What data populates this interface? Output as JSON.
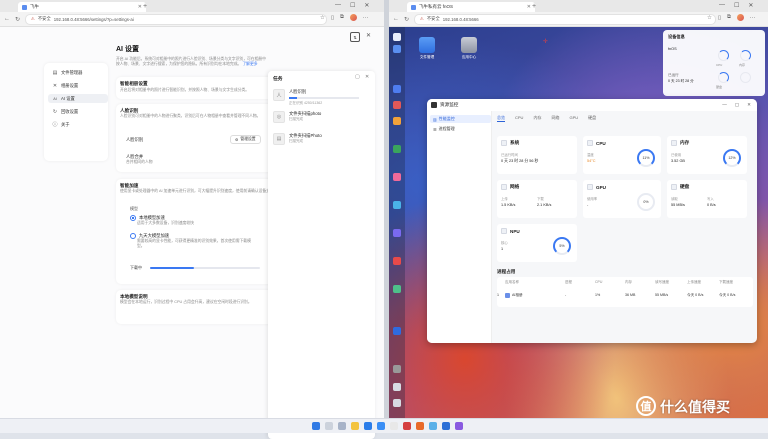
{
  "left_browser": {
    "tab_title": "飞牛",
    "url_warning": "不安全",
    "url": "192.168.0.48:5666/settings/?p=settings-ai",
    "new_tab_symbol": "+",
    "window_buttons": [
      "—",
      "☐",
      "✕"
    ]
  },
  "right_browser": {
    "tab_title": "飞牛私有云 fnOS",
    "url_warning": "不安全",
    "url": "192.168.0.48:5666",
    "new_tab_symbol": "+",
    "window_buttons": [
      "—",
      "☐",
      "✕"
    ]
  },
  "settings": {
    "sidebar": [
      {
        "icon": "▤",
        "label": "文件管理器"
      },
      {
        "icon": "✕",
        "label": "相册设置"
      },
      {
        "icon": "AI",
        "label": "AI 设置"
      },
      {
        "icon": "↻",
        "label": "回收设置"
      },
      {
        "icon": "ⓘ",
        "label": "关于"
      }
    ],
    "title": "AI 设置",
    "description": "开启 AI 功能后，系统可对相册中的照片进行人脸识别、场景分类与文字识别，可在相册中按人物、场景、文字进行搜索，为保护您的隐私，所有识别均在本地完成。",
    "description_link": "了解更多",
    "section1": {
      "title": "智能相册设置",
      "text": "开启后将对相册中的照片进行智能识别，并按照人物、场景与文字生成分类。"
    },
    "section2": {
      "title": "人脸识别",
      "text": "人脸识别可对相册中的人物进行聚类，识别后可在人物相册中查看并管理不同人物。",
      "row_label": "人脸识别",
      "button": "管理设置",
      "row2_label": "人脸合并",
      "row2_sub": "合并相同的人物"
    },
    "section3": {
      "title": "智能加速",
      "text": "使用显卡或处理器中的 AI 加速单元进行识别，可大幅提升识别速度，使用前请确认设备支持。",
      "group_label": "模型",
      "option1": "本地模型加速",
      "option1_sub": "适用于大多数设备，识别速度较快",
      "option2": "九天大模型加速",
      "option2_sub": "需要较高的显卡性能，可获得更精准的识别效果，首次使用需下载模型。",
      "progress_label": "下载中",
      "progress": 0.4
    },
    "section4": {
      "title": "本地模型说明",
      "text": "模型会在本地运行，识别过程中 CPU 占用会升高，建议在空闲时段进行识别。"
    }
  },
  "tasks": {
    "title": "任务",
    "items": [
      {
        "icon": "人",
        "name": "人脸识别",
        "sub": "正在识别 4250/11362",
        "progress": 0.12
      },
      {
        "icon": "◎",
        "name": "文件夹扫描photo",
        "sub": "扫描完成"
      },
      {
        "icon": "▤",
        "name": "文件夹扫描Photo",
        "sub": "扫描完成"
      }
    ]
  },
  "desktop": {
    "icons": [
      {
        "label": "文件管理"
      },
      {
        "label": "应用中心"
      }
    ],
    "widget": {
      "title": "设备信息",
      "line1": "fnOS",
      "line2": "已运行",
      "line3": "0 天 23 时 28 分",
      "rings": [
        "CPU",
        "内存",
        "硬盘"
      ]
    }
  },
  "resource_monitor": {
    "title": "资源监控",
    "sidebar": [
      "性能监控",
      "进程管理"
    ],
    "tabs": [
      "总览",
      "CPU",
      "内存",
      "网络",
      "GPU",
      "硬盘"
    ],
    "cards": {
      "system": {
        "title": "系统",
        "label": "已运行时间",
        "value": "0 天 23 时 28 分 56 秒"
      },
      "cpu": {
        "title": "CPU",
        "label1": "温度",
        "value1": "54°C",
        "gauge": "11%",
        "gauge_value": 0.11
      },
      "mem": {
        "title": "内存",
        "label1": "已使用",
        "value1": "3.52 GB",
        "gauge": "12%",
        "gauge_value": 0.12
      },
      "net": {
        "title": "网络",
        "label1": "上传",
        "value1": "1.5 KB/s",
        "label2": "下载",
        "value2": "2.1 KB/s"
      },
      "gpu": {
        "title": "GPU",
        "label1": "使用率",
        "value1": "-",
        "gauge": "0%",
        "gauge_value": 0
      },
      "disk": {
        "title": "硬盘",
        "label1": "读取",
        "value1": "55 MB/s",
        "label2": "写入",
        "value2": "0 B/s"
      },
      "npu": {
        "title": "NPU",
        "label1": "核心",
        "value1": "1",
        "gauge": "5%",
        "gauge_value": 0.05
      }
    },
    "table": {
      "title": "进程占用",
      "headers": [
        "",
        "应用名称",
        "进程",
        "CPU",
        "内存",
        "读写速度",
        "上传速度",
        "下载速度"
      ],
      "rows": [
        [
          "1",
          "AI相册",
          "-",
          "1%",
          "36 MB",
          "55 MB/s",
          "今天 0 B/s",
          "今天 0 B/s"
        ]
      ]
    }
  },
  "watermark": "什么值得买",
  "colors": {
    "accent": "#3a78f2"
  }
}
